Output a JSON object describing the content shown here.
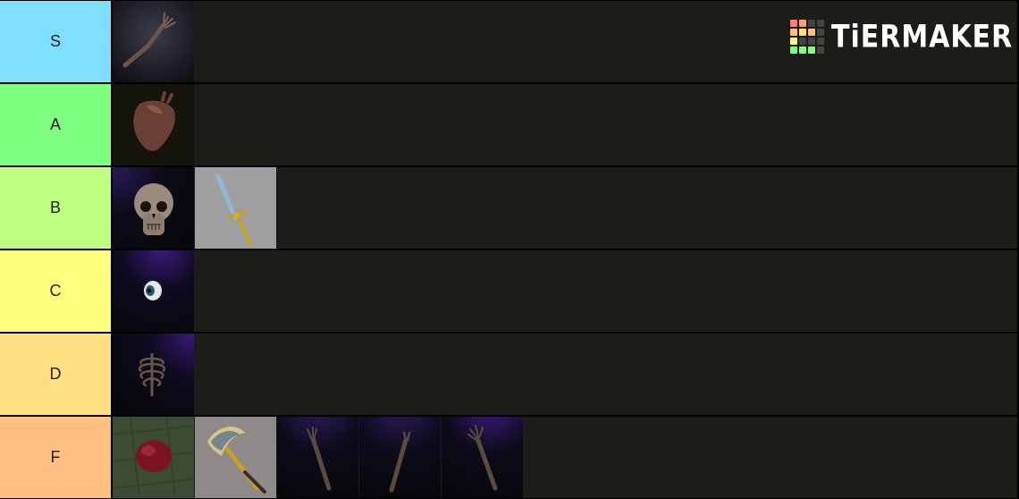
{
  "branding": {
    "logo_text": "TiERMAKER",
    "grid_colors": [
      "#ff7f7f",
      "#ff9f7f",
      "#444",
      "#444",
      "#ffbf7f",
      "#ffdf7f",
      "#ffbf7f",
      "#444",
      "#ffff7f",
      "#444",
      "#444",
      "#444",
      "#7fff7f",
      "#7fff7f",
      "#7fff7f",
      "#444"
    ]
  },
  "tiers": [
    {
      "label": "S",
      "color": "#7fdfff",
      "items": [
        "skeleton-arm"
      ]
    },
    {
      "label": "A",
      "color": "#7fff7f",
      "items": [
        "heart"
      ]
    },
    {
      "label": "B",
      "color": "#bfff7f",
      "items": [
        "skull",
        "sword"
      ]
    },
    {
      "label": "C",
      "color": "#ffff7f",
      "items": [
        "eyeball"
      ]
    },
    {
      "label": "D",
      "color": "#ffdf7f",
      "items": [
        "ribcage"
      ]
    },
    {
      "label": "F",
      "color": "#ffbf7f",
      "items": [
        "red-orb",
        "golden-axe",
        "bone-arm-1",
        "bone-arm-2",
        "bone-arm-3"
      ]
    }
  ]
}
